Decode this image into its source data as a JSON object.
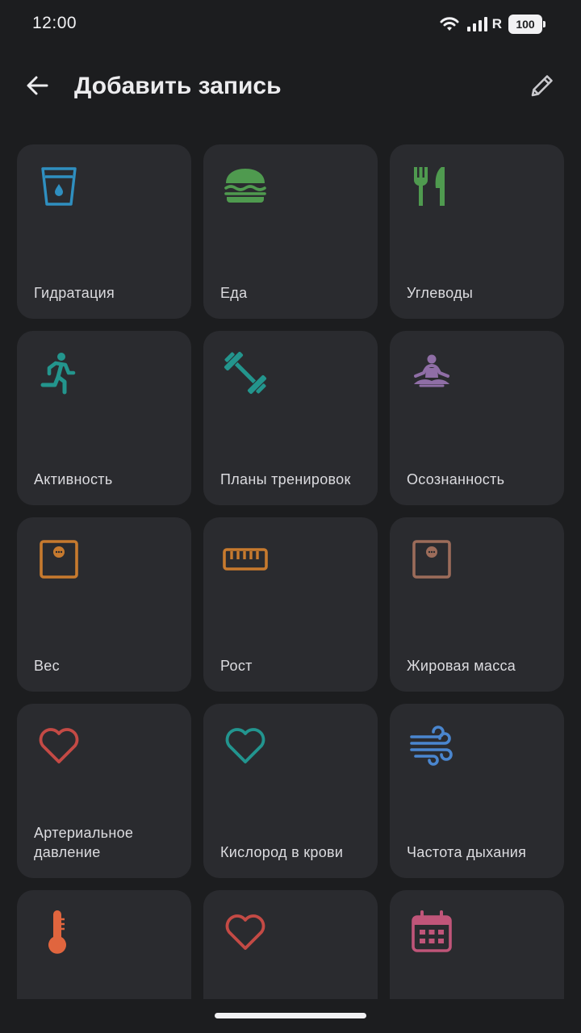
{
  "status_bar": {
    "time": "12:00",
    "network_label": "R",
    "battery": "100",
    "icons": [
      "wifi-icon",
      "signal-icon",
      "battery-icon"
    ]
  },
  "app_bar": {
    "title": "Добавить запись",
    "back_icon": "arrow-back-icon",
    "edit_icon": "pencil-icon"
  },
  "tiles": [
    {
      "label": "Гидратация",
      "icon": "water-glass-icon",
      "color": "#2f8fc0"
    },
    {
      "label": "Еда",
      "icon": "burger-icon",
      "color": "#4f9a4f"
    },
    {
      "label": "Углеводы",
      "icon": "fork-knife-icon",
      "color": "#4f9a4f"
    },
    {
      "label": "Активность",
      "icon": "running-person-icon",
      "color": "#23958d"
    },
    {
      "label": "Планы тренировок",
      "icon": "dumbbell-icon",
      "color": "#23958d"
    },
    {
      "label": "Осознанность",
      "icon": "meditation-icon",
      "color": "#8f6ea6"
    },
    {
      "label": "Вес",
      "icon": "scale-icon",
      "color": "#c77a2e"
    },
    {
      "label": "Рост",
      "icon": "ruler-icon",
      "color": "#c77a2e"
    },
    {
      "label": "Жировая масса",
      "icon": "scale-icon",
      "color": "#9c6c5a"
    },
    {
      "label": "Артериальное давление",
      "icon": "heart-icon",
      "color": "#c44a45"
    },
    {
      "label": "Кислород в крови",
      "icon": "heart-icon",
      "color": "#22958f"
    },
    {
      "label": "Частота дыхания",
      "icon": "wind-icon",
      "color": "#4a86cf"
    },
    {
      "label": "",
      "icon": "thermometer-icon",
      "color": "#e0653e"
    },
    {
      "label": "",
      "icon": "heart-icon",
      "color": "#c44a45"
    },
    {
      "label": "",
      "icon": "calendar-icon",
      "color": "#c05579"
    }
  ]
}
